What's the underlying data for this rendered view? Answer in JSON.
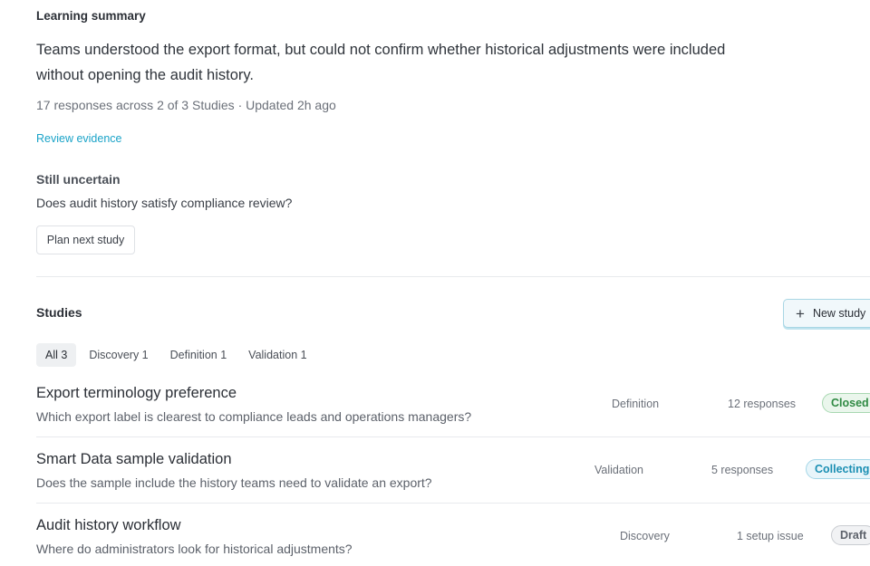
{
  "learning_summary": {
    "heading": "Learning summary",
    "body": "Teams understood the export format, but could not confirm whether historical adjustments were included without opening the audit history.",
    "meta": "17 responses across 2 of 3 Studies · Updated 2h ago",
    "review_link": "Review evidence"
  },
  "uncertain": {
    "heading": "Still uncertain",
    "question": "Does audit history satisfy compliance review?",
    "plan_button": "Plan next study"
  },
  "studies": {
    "heading": "Studies",
    "new_button": "New study",
    "tabs": [
      {
        "label": "All 3",
        "active": true
      },
      {
        "label": "Discovery 1",
        "active": false
      },
      {
        "label": "Definition 1",
        "active": false
      },
      {
        "label": "Validation 1",
        "active": false
      }
    ],
    "rows": [
      {
        "title": "Export terminology preference",
        "question": "Which export label is clearest to compliance leads and operations managers?",
        "phase": "Definition",
        "count": "12 responses",
        "status": "Closed",
        "status_color": "#2f8a43"
      },
      {
        "title": "Smart Data sample validation",
        "question": "Does the sample include the history teams need to validate an export?",
        "phase": "Validation",
        "count": "5 responses",
        "status": "Collecting",
        "status_color": "#1b8fb3"
      },
      {
        "title": "Audit history workflow",
        "question": "Where do administrators look for historical adjustments?",
        "phase": "Discovery",
        "count": "1 setup issue",
        "status": "Draft",
        "status_color": "#5c616a"
      }
    ]
  },
  "icons": {
    "new_study": "plus-icon"
  }
}
